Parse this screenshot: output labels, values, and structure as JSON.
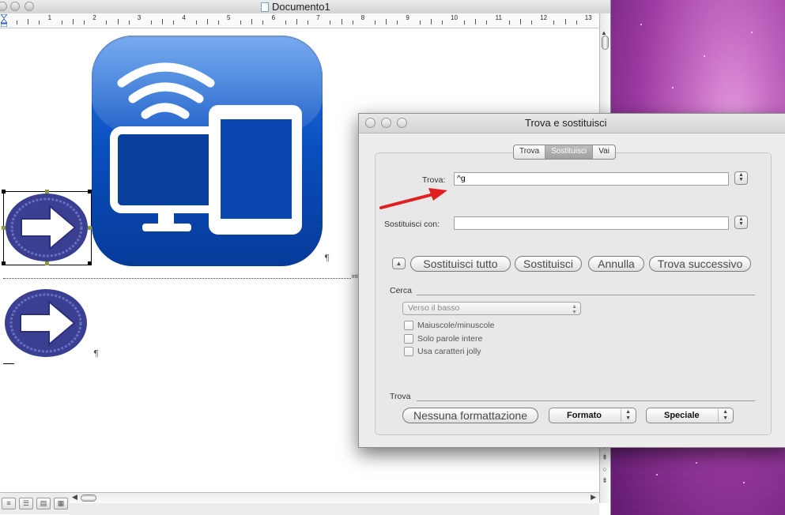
{
  "document_window": {
    "title": "Documento1",
    "ruler_numbers": [
      "1",
      "2",
      "3",
      "4",
      "5",
      "6",
      "7",
      "8",
      "9",
      "10",
      "11",
      "12",
      "13"
    ],
    "margin_label": "int"
  },
  "dialog": {
    "title": "Trova e sostituisci",
    "tabs": [
      {
        "label": "Trova",
        "selected": false
      },
      {
        "label": "Sostituisci",
        "selected": true
      },
      {
        "label": "Vai",
        "selected": false
      }
    ],
    "find_label": "Trova:",
    "find_value": "^g",
    "replace_label": "Sostituisci con:",
    "replace_value": "",
    "buttons": {
      "replace_all": "Sostituisci tutto",
      "replace": "Sostituisci",
      "cancel": "Annulla",
      "find_next": "Trova successivo"
    },
    "search_section_label": "Cerca",
    "direction_value": "Verso il basso",
    "options": [
      {
        "label": "Maiuscole/minuscole",
        "checked": false
      },
      {
        "label": "Solo parole intere",
        "checked": false
      },
      {
        "label": "Usa caratteri jolly",
        "checked": false
      }
    ],
    "find_section_label": "Trova",
    "no_format_button": "Nessuna formattazione",
    "format_button": "Formato",
    "special_button": "Speciale"
  },
  "colors": {
    "icon_blue": "#0a4fbf",
    "arrow_annotation": "#e02020",
    "desktop_purple": "#9b3aa0"
  },
  "icons": {
    "pilcrow": "¶"
  }
}
